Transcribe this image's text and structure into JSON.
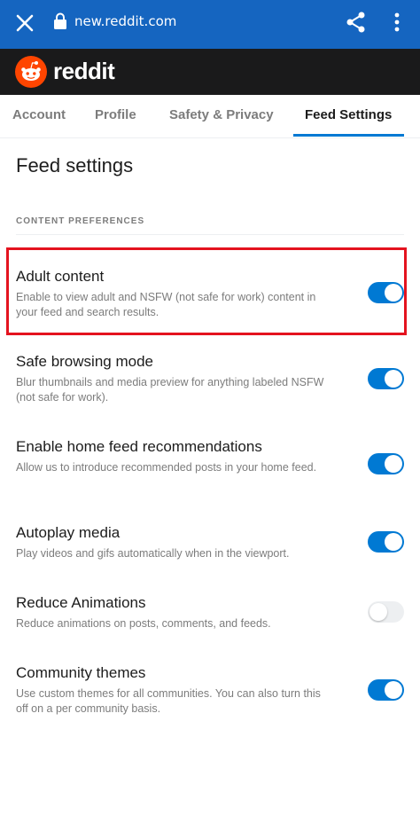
{
  "browser": {
    "url": "new.reddit.com",
    "close_icon": "close-icon",
    "lock_icon": "lock-icon",
    "share_icon": "share-icon",
    "menu_icon": "more-vert-icon",
    "bar_color": "#1565c0"
  },
  "header": {
    "logo_icon": "reddit-snoo-icon",
    "logo_text": "reddit",
    "logo_color": "#ff4500"
  },
  "tabs": [
    {
      "label": "Account",
      "active": false
    },
    {
      "label": "Profile",
      "active": false
    },
    {
      "label": "Safety & Privacy",
      "active": false
    },
    {
      "label": "Feed Settings",
      "active": true
    }
  ],
  "page": {
    "title": "Feed settings",
    "section_label": "CONTENT PREFERENCES"
  },
  "settings": [
    {
      "title": "Adult content",
      "description": "Enable to view adult and NSFW (not safe for work) content in your feed and search results.",
      "enabled": true
    },
    {
      "title": "Safe browsing mode",
      "description": "Blur thumbnails and media preview for anything labeled NSFW (not safe for work).",
      "enabled": true
    },
    {
      "title": "Enable home feed recommendations",
      "description": "Allow us to introduce recommended posts in your home feed.",
      "enabled": true
    },
    {
      "title": "Autoplay media",
      "description": "Play videos and gifs automatically when in the viewport.",
      "enabled": true
    },
    {
      "title": "Reduce Animations",
      "description": "Reduce animations on posts, comments, and feeds.",
      "enabled": false
    },
    {
      "title": "Community themes",
      "description": "Use custom themes for all communities. You can also turn this off on a per community basis.",
      "enabled": true
    }
  ],
  "colors": {
    "accent": "#0079d3",
    "highlight": "#e4131f"
  }
}
